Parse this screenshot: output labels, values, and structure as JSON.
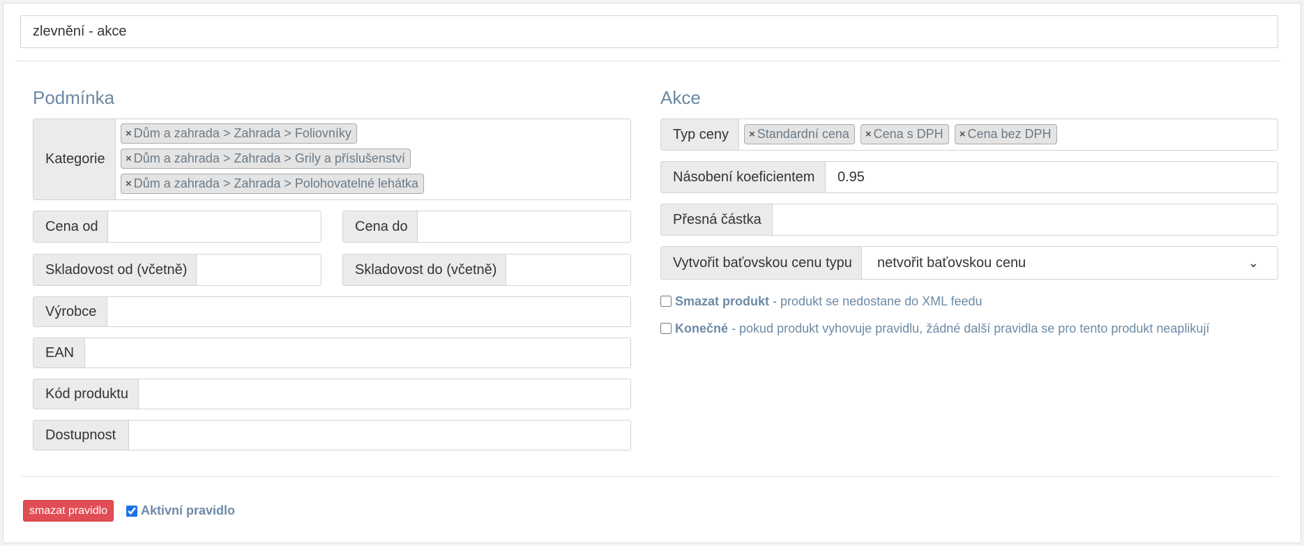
{
  "rule_name": "zlevnění - akce",
  "condition": {
    "title": "Podmínka",
    "category_label": "Kategorie",
    "categories": [
      "Dům a zahrada > Zahrada > Foliovníky",
      "Dům a zahrada > Zahrada > Grily a příslušenství",
      "Dům a zahrada > Zahrada > Polohovatelné lehátka"
    ],
    "price_from_label": "Cena od",
    "price_from_value": "",
    "price_to_label": "Cena do",
    "price_to_value": "",
    "stock_from_label": "Skladovost od (včetně)",
    "stock_from_value": "",
    "stock_to_label": "Skladovost do (včetně)",
    "stock_to_value": "",
    "manufacturer_label": "Výrobce",
    "manufacturer_value": "",
    "ean_label": "EAN",
    "ean_value": "",
    "product_code_label": "Kód produktu",
    "product_code_value": "",
    "availability_label": "Dostupnost",
    "availability_value": ""
  },
  "action": {
    "title": "Akce",
    "price_type_label": "Typ ceny",
    "price_types": [
      "Standardní cena",
      "Cena s DPH",
      "Cena bez DPH"
    ],
    "multiplier_label": "Násobení koeficientem",
    "multiplier_value": "0.95",
    "exact_amount_label": "Přesná částka",
    "exact_amount_value": "",
    "bata_price_label": "Vytvořit baťovskou cenu typu",
    "bata_price_selected": "netvořit baťovskou cenu",
    "delete_product_bold": "Smazat produkt",
    "delete_product_text": "- produkt se nedostane do XML feedu",
    "delete_product_checked": false,
    "final_bold": "Konečné",
    "final_text": "- pokud produkt vyhovuje pravidlu, žádné další pravidla se pro tento produkt neaplikují",
    "final_checked": false
  },
  "footer": {
    "delete_rule_label": "smazat pravidlo",
    "active_rule_label": "Aktivní pravidlo",
    "active_rule_checked": true
  },
  "colors": {
    "accent_title": "#6b88a4",
    "danger": "#e14d54"
  }
}
